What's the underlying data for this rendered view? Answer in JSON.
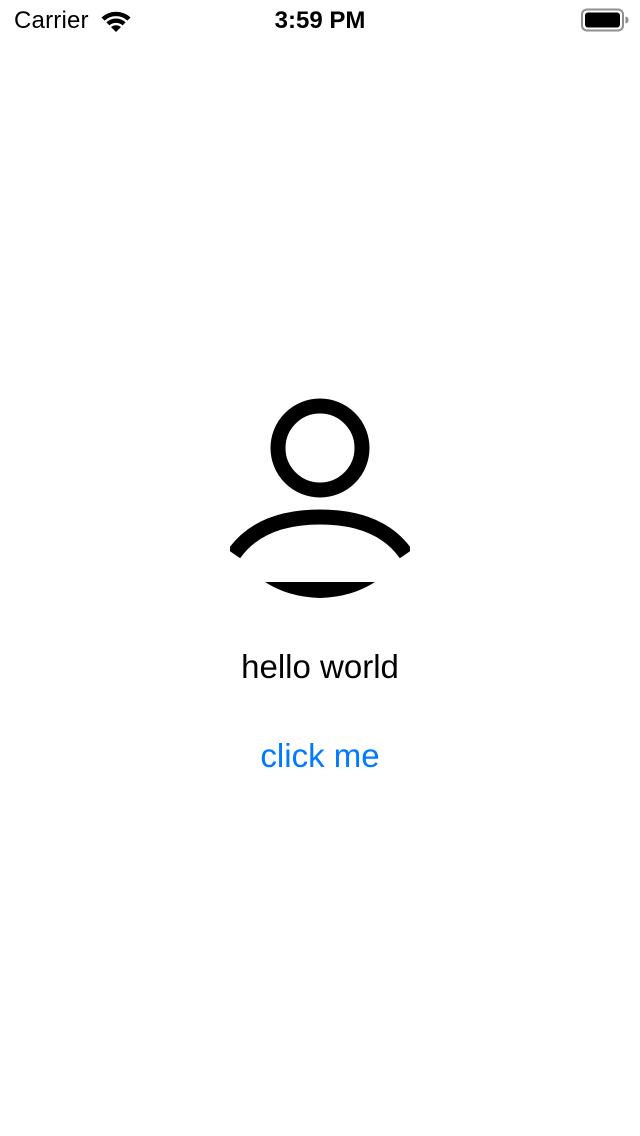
{
  "status_bar": {
    "carrier": "Carrier",
    "time": "3:59 PM",
    "wifi_icon": "wifi-icon",
    "battery_icon": "battery-icon",
    "battery_level": 1.0
  },
  "main": {
    "avatar_icon": "person-icon",
    "greeting": "hello world",
    "button_label": "click me"
  },
  "colors": {
    "background": "#ffffff",
    "text": "#000000",
    "tint": "#007aff"
  }
}
